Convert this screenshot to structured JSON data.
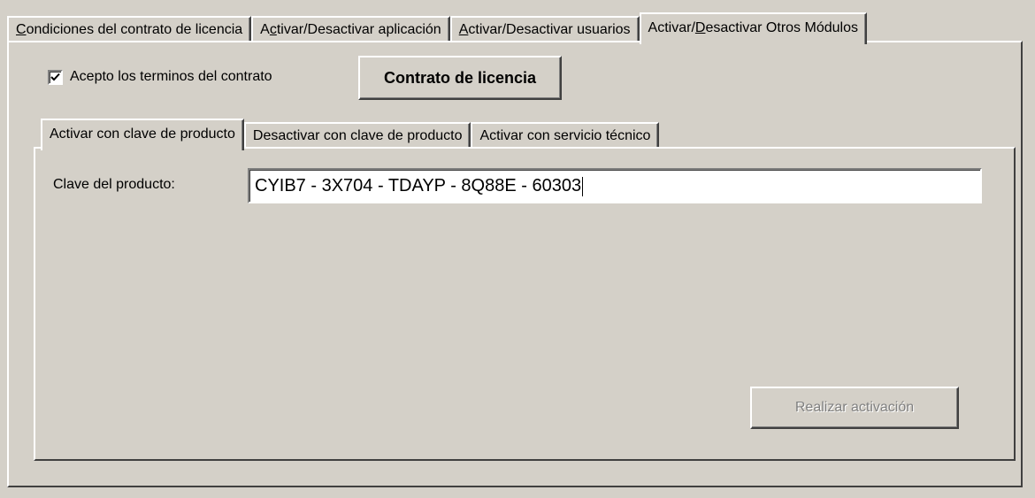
{
  "outer_tabs": [
    {
      "pre": "",
      "mnemonic": "C",
      "post": "ondiciones del contrato de licencia"
    },
    {
      "pre": "A",
      "mnemonic": "c",
      "post": "tivar/Desactivar aplicación"
    },
    {
      "pre": "",
      "mnemonic": "A",
      "post": "ctivar/Desactivar usuarios"
    },
    {
      "pre": "Activar/",
      "mnemonic": "D",
      "post": "esactivar Otros Módulos"
    }
  ],
  "active_outer_tab": 3,
  "license": {
    "accept_label": "Acepto los terminos del contrato",
    "accept_checked": true,
    "contract_button": "Contrato de licencia"
  },
  "inner_tabs": [
    {
      "label": "Activar con clave de producto"
    },
    {
      "label": "Desactivar con clave de producto"
    },
    {
      "label": "Activar con servicio técnico"
    }
  ],
  "active_inner_tab": 0,
  "activation": {
    "key_label": "Clave del producto:",
    "key_value": "CYIB7 - 3X704 - TDAYP - 8Q88E - 60303",
    "submit_button": "Realizar activación",
    "submit_enabled": false
  }
}
